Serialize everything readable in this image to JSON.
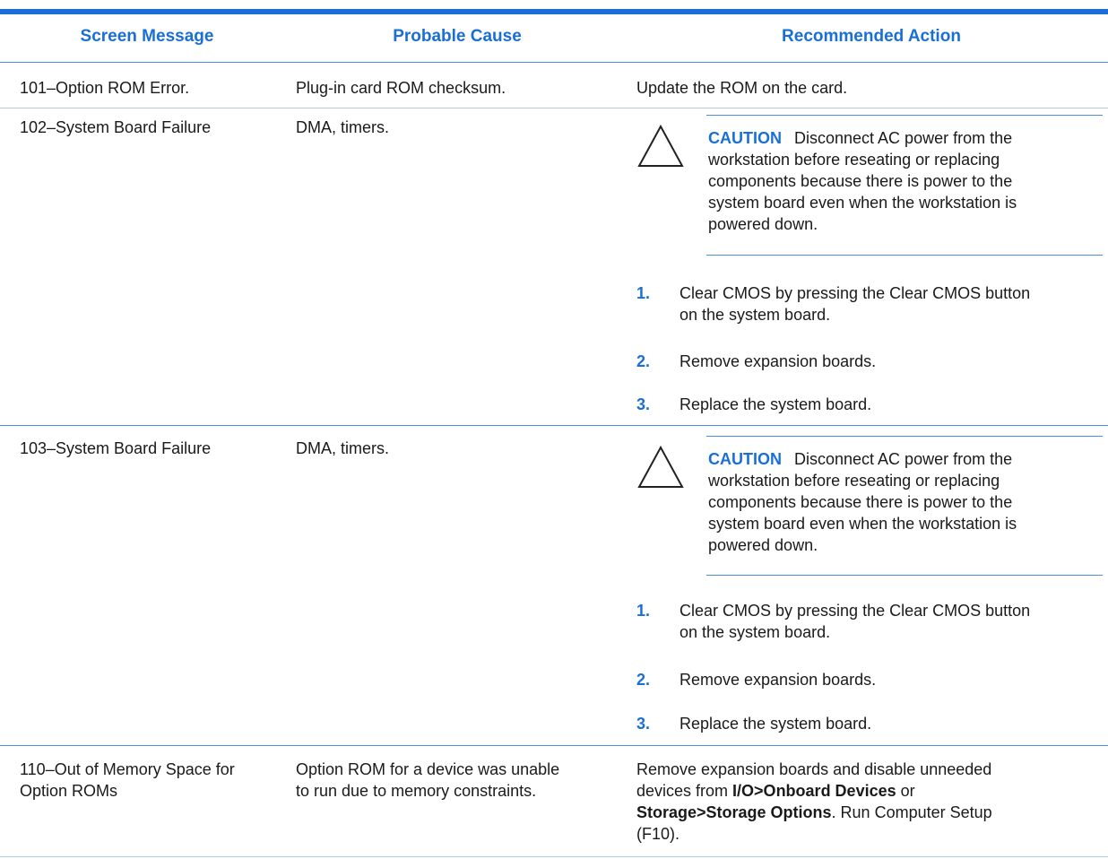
{
  "headers": {
    "screen_message": "Screen Message",
    "probable_cause": "Probable Cause",
    "recommended_action": "Recommended Action"
  },
  "rows": [
    {
      "message": "101–Option ROM Error.",
      "cause": "Plug-in card ROM checksum.",
      "action": "Update the ROM on the card."
    },
    {
      "message": "102–System Board Failure",
      "cause": "DMA, timers.",
      "caution_label": "CAUTION",
      "caution_lines": [
        "Disconnect AC power from the",
        "workstation before reseating or replacing",
        "components because there is power to the",
        "system board even when the workstation is",
        "powered down."
      ],
      "steps": [
        {
          "num": "1.",
          "lines": [
            "Clear CMOS by pressing the Clear CMOS button",
            "on the system board."
          ]
        },
        {
          "num": "2.",
          "lines": [
            "Remove expansion boards."
          ]
        },
        {
          "num": "3.",
          "lines": [
            "Replace the system board."
          ]
        }
      ]
    },
    {
      "message": "103–System Board Failure",
      "cause": "DMA, timers.",
      "caution_label": "CAUTION",
      "caution_lines": [
        "Disconnect AC power from the",
        "workstation before reseating or replacing",
        "components because there is power to the",
        "system board even when the workstation is",
        "powered down."
      ],
      "steps": [
        {
          "num": "1.",
          "lines": [
            "Clear CMOS by pressing the Clear CMOS button",
            "on the system board."
          ]
        },
        {
          "num": "2.",
          "lines": [
            "Remove expansion boards."
          ]
        },
        {
          "num": "3.",
          "lines": [
            "Replace the system board."
          ]
        }
      ]
    },
    {
      "message_lines": [
        "110–Out of Memory Space for",
        "Option ROMs"
      ],
      "cause_lines": [
        "Option ROM for a device was unable",
        "to run due to memory constraints."
      ],
      "action_parts": {
        "l1": "Remove expansion boards and disable unneeded",
        "l2_pre": "devices from ",
        "l2_bold": "I/O>Onboard Devices",
        "l2_post": " or",
        "l3_bold": "Storage>Storage Options",
        "l3_post": ". Run Computer Setup",
        "l4": "(F10)."
      }
    }
  ]
}
